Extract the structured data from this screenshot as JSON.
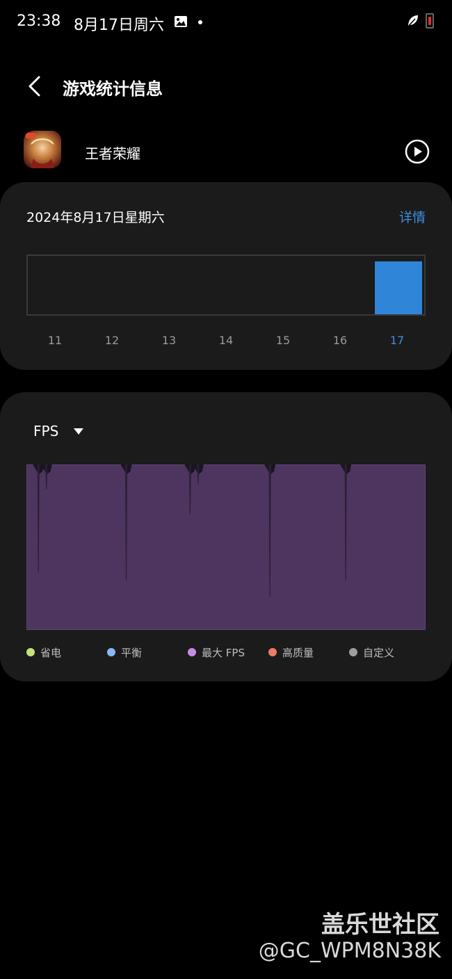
{
  "status_bar": {
    "time": "23:38",
    "date": "8月17日周六",
    "icons": [
      "image-icon",
      "notification-dot",
      "leaf-icon",
      "battery-low-icon"
    ]
  },
  "header": {
    "title": "游戏统计信息",
    "back_icon": "chevron-left-icon"
  },
  "game": {
    "name": "王者荣耀",
    "play_icon": "play-circle-icon"
  },
  "usage_card": {
    "date": "2024年8月17日星期六",
    "details_label": "详情",
    "days": [
      "11",
      "12",
      "13",
      "14",
      "15",
      "16",
      "17"
    ],
    "active_day": "17",
    "accent": "#2f86d9"
  },
  "chart_data": [
    {
      "type": "bar",
      "categories": [
        "11",
        "12",
        "13",
        "14",
        "15",
        "16",
        "17"
      ],
      "values": [
        0,
        0,
        0,
        0,
        0,
        0,
        1
      ],
      "ylim": [
        0,
        1
      ],
      "bar_color": "#2f86d9"
    },
    {
      "type": "area",
      "dips": [
        {
          "x": 0.03,
          "depth": 0.65
        },
        {
          "x": 0.05,
          "depth": 0.15
        },
        {
          "x": 0.25,
          "depth": 0.7
        },
        {
          "x": 0.41,
          "depth": 0.3
        },
        {
          "x": 0.43,
          "depth": 0.12
        },
        {
          "x": 0.61,
          "depth": 0.8
        },
        {
          "x": 0.8,
          "depth": 0.7
        }
      ],
      "fill_color": "#4e3560",
      "edge_color": "#5c4470"
    }
  ],
  "fps_card": {
    "metric_label": "FPS",
    "dropdown_icon": "caret-down-icon",
    "legend": [
      {
        "label": "省电",
        "color": "#c4e27a"
      },
      {
        "label": "平衡",
        "color": "#8ab7f5"
      },
      {
        "label": "最大 FPS",
        "color": "#c58ae6"
      },
      {
        "label": "高质量",
        "color": "#f07a63"
      },
      {
        "label": "自定义",
        "color": "#9e9e9e"
      }
    ]
  },
  "watermark": {
    "line1": "盖乐世社区",
    "line2": "@GC_WPM8N38K"
  }
}
